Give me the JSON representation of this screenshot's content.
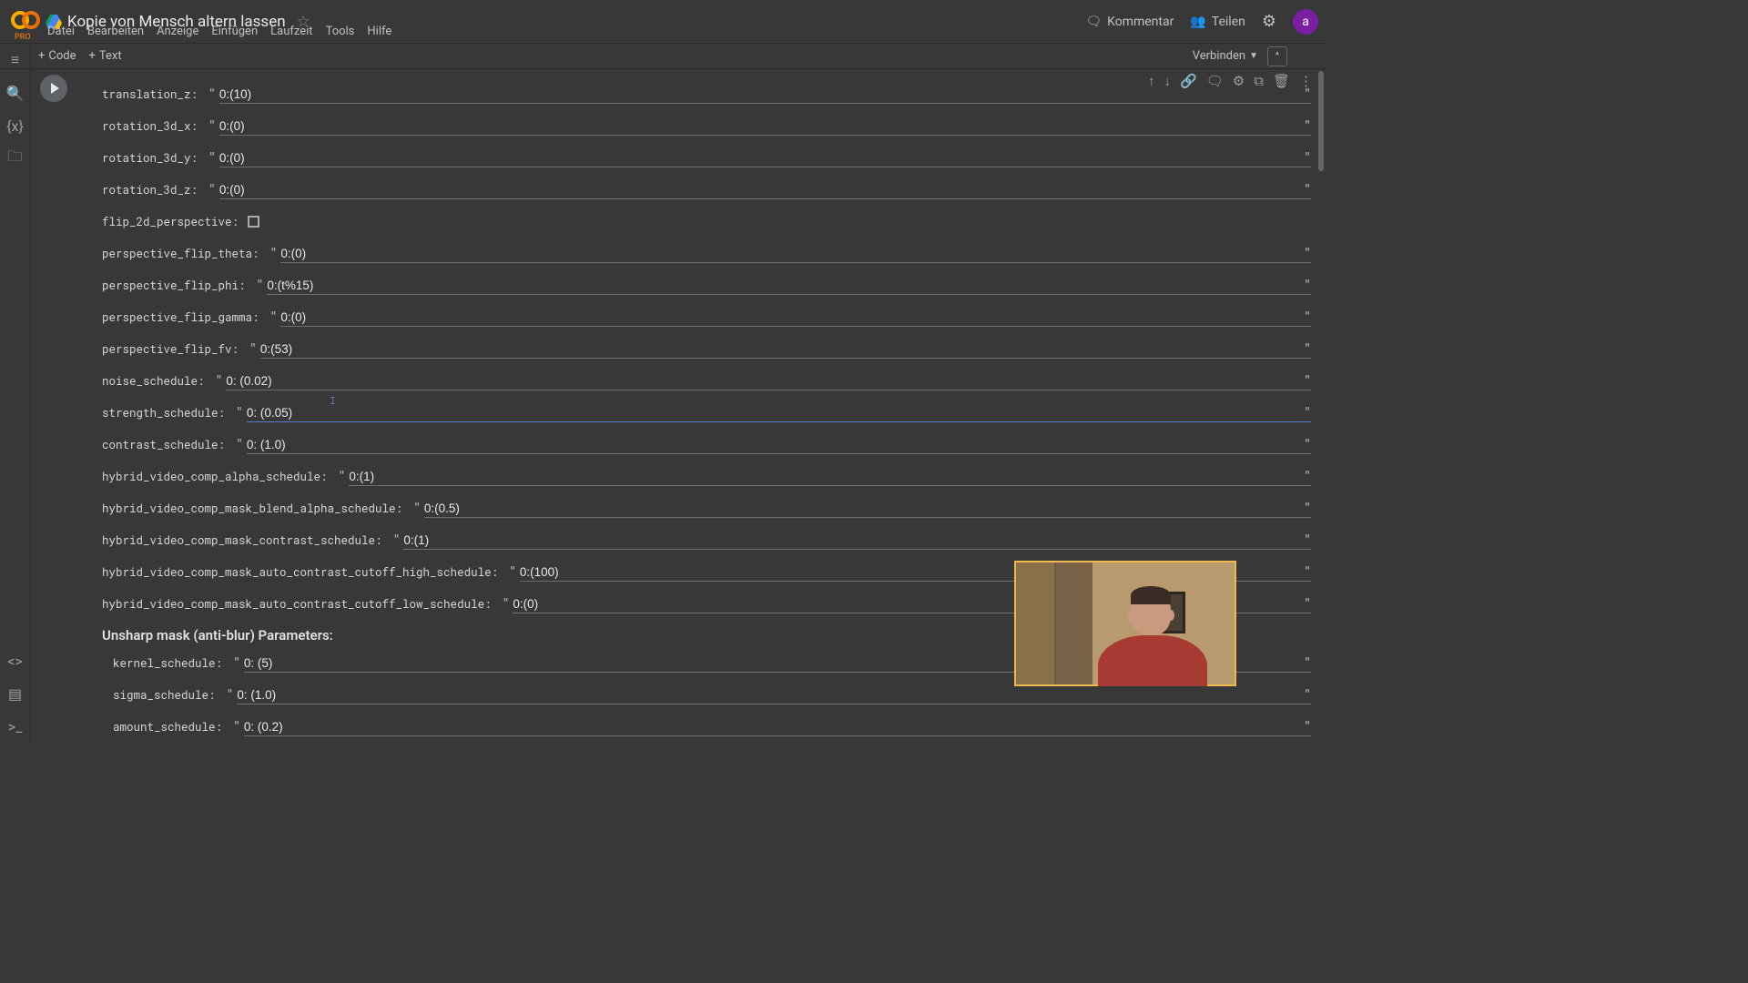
{
  "header": {
    "pro": "PRO",
    "title": "Kopie von Mensch altern lassen",
    "comment": "Kommentar",
    "share": "Teilen",
    "avatar": "a"
  },
  "menu": {
    "file": "Datei",
    "edit": "Bearbeiten",
    "view": "Anzeige",
    "insert": "Einfügen",
    "runtime": "Laufzeit",
    "tools": "Tools",
    "help": "Hilfe"
  },
  "toolbar": {
    "code": "Code",
    "text": "Text",
    "connect": "Verbinden"
  },
  "params": [
    {
      "label": "translation_z:",
      "value": "0:(10)"
    },
    {
      "label": "rotation_3d_x:",
      "value": "0:(0)"
    },
    {
      "label": "rotation_3d_y:",
      "value": "0:(0)"
    },
    {
      "label": "rotation_3d_z:",
      "value": "0:(0)"
    },
    {
      "label": "flip_2d_perspective:",
      "type": "checkbox"
    },
    {
      "label": "perspective_flip_theta:",
      "value": "0:(0)"
    },
    {
      "label": "perspective_flip_phi:",
      "value": "0:(t%15)"
    },
    {
      "label": "perspective_flip_gamma:",
      "value": "0:(0)"
    },
    {
      "label": "perspective_flip_fv:",
      "value": "0:(53)"
    },
    {
      "label": "noise_schedule:",
      "value": "0: (0.02)"
    },
    {
      "label": "strength_schedule:",
      "value": "0: (0.05)",
      "focused": true
    },
    {
      "label": "contrast_schedule:",
      "value": "0: (1.0)"
    },
    {
      "label": "hybrid_video_comp_alpha_schedule:",
      "value": "0:(1)"
    },
    {
      "label": "hybrid_video_comp_mask_blend_alpha_schedule:",
      "value": "0:(0.5)"
    },
    {
      "label": "hybrid_video_comp_mask_contrast_schedule:",
      "value": "0:(1)"
    },
    {
      "label": "hybrid_video_comp_mask_auto_contrast_cutoff_high_schedule:",
      "value": "0:(100)"
    },
    {
      "label": "hybrid_video_comp_mask_auto_contrast_cutoff_low_schedule:",
      "value": "0:(0)"
    }
  ],
  "section": "Unsharp mask (anti-blur) Parameters:",
  "unsharp": [
    {
      "label": "kernel_schedule:",
      "value": "0: (5)"
    },
    {
      "label": "sigma_schedule:",
      "value": "0: (1.0)"
    },
    {
      "label": "amount_schedule:",
      "value": "0: (0.2)"
    }
  ]
}
